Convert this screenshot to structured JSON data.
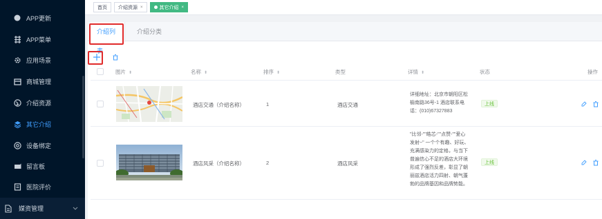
{
  "sidebar": {
    "items": [
      {
        "label": "APP更新",
        "icon": "circle-icon"
      },
      {
        "label": "APP菜单",
        "icon": "grid-icon"
      },
      {
        "label": "应用场景",
        "icon": "gear-icon"
      },
      {
        "label": "商城管理",
        "icon": "shop-icon"
      },
      {
        "label": "介绍资源",
        "icon": "globe-icon"
      },
      {
        "label": "其它介绍",
        "icon": "layers-icon"
      },
      {
        "label": "设备绑定",
        "icon": "device-icon"
      },
      {
        "label": "留言板",
        "icon": "message-icon"
      },
      {
        "label": "医院评价",
        "icon": "review-icon"
      }
    ],
    "active_index": 5,
    "group": {
      "label": "媒资管理",
      "icon": "document-icon"
    }
  },
  "tagbar": {
    "tags": [
      {
        "label": "首页"
      },
      {
        "label": "介绍资源"
      },
      {
        "label": "其它介绍"
      }
    ]
  },
  "tabs": [
    "介绍列表",
    "介绍分类"
  ],
  "table": {
    "headers": {
      "image": "图片",
      "name": "名称",
      "sort": "排序",
      "type": "类型",
      "detail": "详情",
      "status": "状态",
      "actions": "操作"
    },
    "rows": [
      {
        "image": "map-thumbnail",
        "name": "酒店交通（介绍名称）",
        "sort": "1",
        "type": "酒店交通",
        "detail": [
          "详细地址：北京市朝阳区松",
          "榆南路36号-1 酒店联系电",
          "话：(010)67327883"
        ],
        "status": "上线"
      },
      {
        "image": "building-photo",
        "name": "酒店风采（介绍名称）",
        "sort": "2",
        "type": "酒店风采",
        "detail": [
          "\"比邻-\"\"皓芯-\"\"点赞-\"\"爱心",
          "发射~\" 一个个有趣、好玩、",
          "充满感染力的定格，与当下",
          "普遍信心不足的酒店大环境",
          "形成了强烈反差，彰显了朝",
          "丽兹酒店活力四射、朝气蓬",
          "勃的品牌基因和品牌势能。"
        ],
        "status": "上线"
      }
    ]
  },
  "colors": {
    "sidebar_bg": "#001529",
    "accent": "#409eff",
    "active_tag": "#42b983",
    "status_green": "#67c23a",
    "highlight_red": "#e02a2a"
  }
}
